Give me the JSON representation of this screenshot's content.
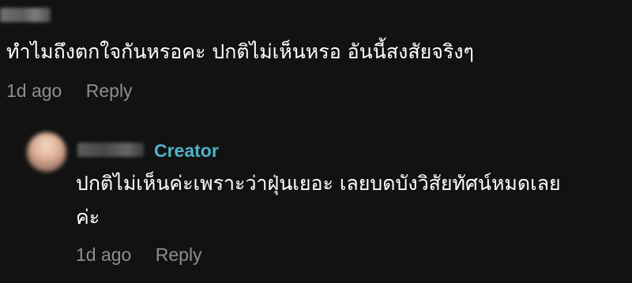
{
  "top_comment": {
    "text": "ทำไมถึงตกใจกันหรอคะ ปกติไม่เห็นหรอ อันนี้สงสัยจริงๆ",
    "time": "1d ago",
    "reply_label": "Reply"
  },
  "reply_comment": {
    "badge": "Creator",
    "text_line1": "ปกติไม่เห็นค่ะเพราะว่าฝุ่นเยอะ เลยบดบังวิสัยทัศน์หมดเลย",
    "text_line2": "ค่ะ",
    "time": "1d ago",
    "reply_label": "Reply"
  },
  "colors": {
    "background": "#121212",
    "text": "#ffffff",
    "meta": "#8e8e8e",
    "creator": "#4fb3c8"
  }
}
